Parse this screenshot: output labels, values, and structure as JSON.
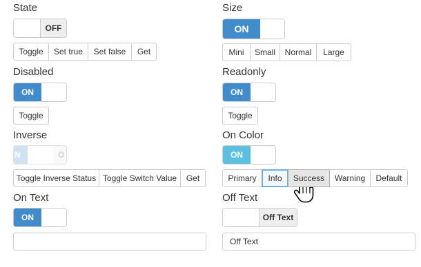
{
  "state": {
    "title": "State",
    "switch": {
      "off_label": "OFF"
    },
    "buttons": [
      "Toggle",
      "Set true",
      "Set false",
      "Get"
    ]
  },
  "size": {
    "title": "Size",
    "switch": {
      "on_label": "ON"
    },
    "buttons": [
      "Mini",
      "Small",
      "Normal",
      "Large"
    ]
  },
  "disabled": {
    "title": "Disabled",
    "switch": {
      "on_label": "ON"
    },
    "buttons": [
      "Toggle"
    ]
  },
  "readonly": {
    "title": "Readonly",
    "switch": {
      "on_label": "ON"
    },
    "buttons": [
      "Toggle"
    ]
  },
  "inverse": {
    "title": "Inverse",
    "switch": {
      "on_label_clipped": "N",
      "off_label_clipped": "O"
    },
    "buttons": [
      "Toggle Inverse Status",
      "Toggle Switch Value",
      "Get"
    ]
  },
  "on_color": {
    "title": "On Color",
    "switch": {
      "on_label": "ON"
    },
    "buttons": [
      "Primary",
      "Info",
      "Success",
      "Warning",
      "Default"
    ],
    "selected": "Info",
    "hovered": "Success"
  },
  "on_text": {
    "title": "On Text",
    "switch": {
      "on_label": "ON"
    },
    "input_value": ""
  },
  "off_text": {
    "title": "Off Text",
    "switch": {
      "off_label": "Off Text"
    },
    "input_value": "Off Text"
  },
  "colors": {
    "primary": "#428bca",
    "info": "#5bc0de",
    "off_bg": "#eeeeee",
    "border": "#cccccc"
  },
  "icons": {
    "cursor": "hand-pointer-icon"
  }
}
